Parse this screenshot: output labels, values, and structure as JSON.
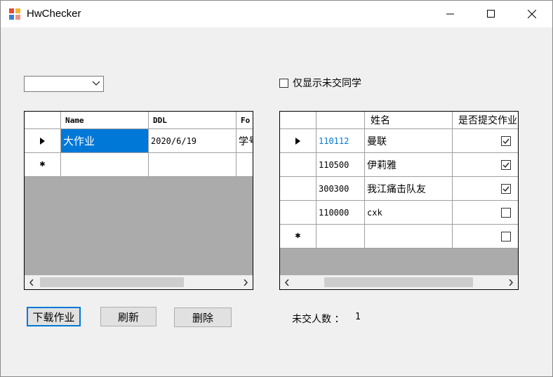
{
  "window": {
    "title": "HwChecker"
  },
  "left_panel": {
    "combo": {
      "value": ""
    },
    "grid": {
      "columns": [
        "",
        "Name",
        "DDL",
        "Fo"
      ],
      "rows": [
        {
          "marker": "current",
          "name": "大作业",
          "ddl": "2020/6/19",
          "fo": "学号"
        },
        {
          "marker": "new",
          "name": "",
          "ddl": "",
          "fo": ""
        }
      ]
    },
    "buttons": {
      "download": "下载作业",
      "refresh": "刷新",
      "delete": "删除"
    }
  },
  "right_panel": {
    "checkbox": {
      "label": "仅显示未交同学",
      "checked": false
    },
    "grid": {
      "columns": [
        "",
        "",
        "姓名",
        "是否提交作业"
      ],
      "rows": [
        {
          "marker": "current",
          "id": "110112",
          "name": "曼联",
          "submitted": true
        },
        {
          "marker": "",
          "id": "110500",
          "name": "伊莉雅",
          "submitted": true
        },
        {
          "marker": "",
          "id": "300300",
          "name": "我江痛击队友",
          "submitted": true
        },
        {
          "marker": "",
          "id": "110000",
          "name": "cxk",
          "submitted": false
        },
        {
          "marker": "new",
          "id": "",
          "name": "",
          "submitted": false
        }
      ]
    },
    "status": {
      "label": "未交人数 ：",
      "value": "1"
    }
  },
  "icons": {
    "app": "app-icon",
    "current_row": "row-pointer-icon",
    "new_row": "new-row-icon",
    "check": "check-icon"
  }
}
